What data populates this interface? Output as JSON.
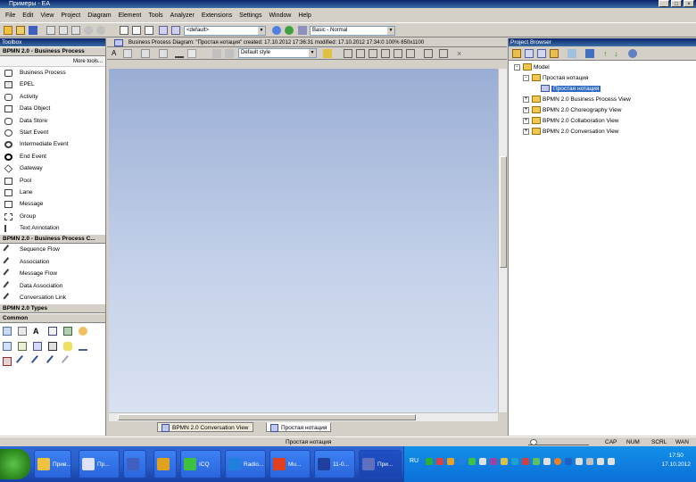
{
  "window": {
    "title": "Примеры - EA",
    "buttons": [
      "_",
      "□",
      "×"
    ]
  },
  "menu": [
    "File",
    "Edit",
    "View",
    "Project",
    "Diagram",
    "Element",
    "Tools",
    "Analyzer",
    "Extensions",
    "Settings",
    "Window",
    "Help"
  ],
  "toolbar": {
    "perspective_combo": "<default>",
    "layout_combo": "Basic - Normal"
  },
  "toolbox": {
    "title": "Toolbox",
    "more_tools": "More tools...",
    "section1": "BPMN 2.0 - Business Process",
    "items1": [
      "Business Process",
      "EPEL",
      "Activity",
      "Data Object",
      "Data Store",
      "Start Event",
      "Intermediate Event",
      "End Event",
      "Gateway",
      "Pool",
      "Lane",
      "Message",
      "Group",
      "Text Annotation"
    ],
    "section2": "BPMN 2.0 - Business Process C...",
    "items2": [
      "Sequence Flow",
      "Association",
      "Message Flow",
      "Data Association",
      "Conversation Link"
    ],
    "section3": "BPMN 2.0 Types",
    "section4": "Common"
  },
  "document": {
    "tab_text": "Business Process Diagram: \"Простая нотация\"  created: 17.10.2012 17:36:31  modified: 17.10.2012 17:34:0  100%  850x1100",
    "style_combo": "Default style",
    "bottom_tabs": [
      "BPMN 2.0 Conversation View",
      "Простая нотация"
    ]
  },
  "project_browser": {
    "title": "Project Browser",
    "tree": [
      {
        "label": "Model",
        "level": 0,
        "exp": "-"
      },
      {
        "label": "Простая нотация",
        "level": 1,
        "exp": "-"
      },
      {
        "label": "Простая нотация",
        "level": 2,
        "exp": "",
        "selected": true
      },
      {
        "label": "BPMN 2.0 Business Process View",
        "level": 1,
        "exp": "+"
      },
      {
        "label": "BPMN 2.0 Choreography View",
        "level": 1,
        "exp": "+"
      },
      {
        "label": "BPMN 2.0 Collaboration View",
        "level": 1,
        "exp": "+"
      },
      {
        "label": "BPMN 2.0 Conversation View",
        "level": 1,
        "exp": "+"
      }
    ]
  },
  "statusbar": {
    "center_text": "Простая нотация",
    "cap": "CAP",
    "num": "NUM",
    "scrl": "SCRL",
    "wan": "WAN"
  },
  "taskbar": {
    "tasks": [
      "Прив...",
      "Пр...",
      "",
      "",
      "ICQ",
      "Radio...",
      "Mu...",
      "11-0...",
      "При..."
    ],
    "lang": "RU",
    "time": "17:50",
    "date": "17.10.2012"
  },
  "colors": {
    "title_gradient_start": "#0a246a",
    "canvas_top": "#9aaed4",
    "selection": "#316ac5",
    "taskbar": "#2a5ec8"
  }
}
